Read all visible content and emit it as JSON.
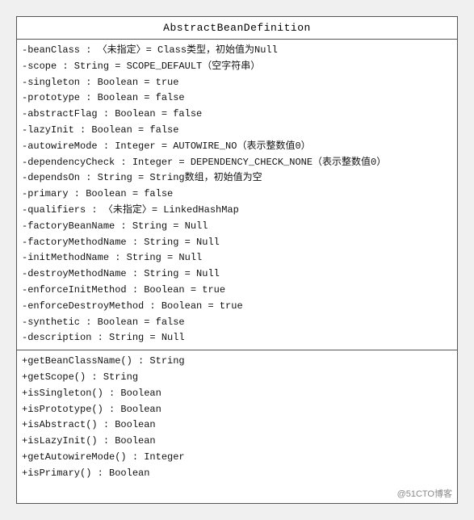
{
  "diagram": {
    "title": "AbstractBeanDefinition",
    "fields": [
      "-beanClass : 〈未指定〉= Class类型，初始值为Null",
      "-scope : String = SCOPE_DEFAULT（空字符串）",
      "-singleton : Boolean = true",
      "-prototype : Boolean = false",
      "-abstractFlag : Boolean = false",
      "-lazyInit : Boolean = false",
      "-autowireMode : Integer = AUTOWIRE_NO（表示整数值0）",
      "-dependencyCheck : Integer = DEPENDENCY_CHECK_NONE（表示整数值0）",
      "-dependsOn : String = String数组，初始值为空",
      "-primary : Boolean = false",
      "-qualifiers : 〈未指定〉= LinkedHashMap",
      "-factoryBeanName : String = Null",
      "-factoryMethodName : String = Null",
      "-initMethodName : String = Null",
      "-destroyMethodName : String = Null",
      "-enforceInitMethod : Boolean = true",
      "-enforceDestroyMethod : Boolean = true",
      "-synthetic : Boolean = false",
      "-description : String = Null"
    ],
    "methods": [
      "+getBeanClassName() : String",
      "+getScope() : String",
      "+isSingleton() : Boolean",
      "+isPrototype() : Boolean",
      "+isAbstract() : Boolean",
      "+isLazyInit() : Boolean",
      "+getAutowireMode() : Integer",
      "+isPrimary() : Boolean"
    ],
    "watermark": "@51CTO博客"
  }
}
